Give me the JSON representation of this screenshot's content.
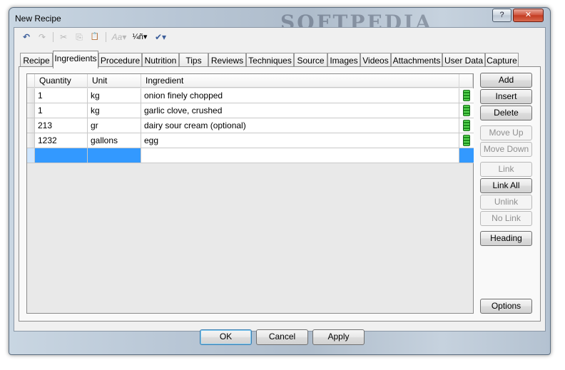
{
  "window": {
    "title": "New Recipe",
    "watermark": "SOFTPEDIA",
    "help_label": "?",
    "close_label": "✕"
  },
  "toolbar": {
    "undo": "↶",
    "redo": "↷",
    "cut": "✂",
    "copy": "⎘",
    "paste": "📋",
    "font": "Aa▾",
    "fraction": "¼ñ▾",
    "spell": "✔▾"
  },
  "tabs": [
    "Recipe",
    "Ingredients",
    "Procedure",
    "Nutrition",
    "Tips",
    "Reviews",
    "Techniques",
    "Source",
    "Images",
    "Videos",
    "Attachments",
    "User Data",
    "Capture"
  ],
  "active_tab": "Ingredients",
  "grid": {
    "columns": [
      "Quantity",
      "Unit",
      "Ingredient"
    ],
    "rows": [
      {
        "quantity": "1",
        "unit": "kg",
        "ingredient": "onion finely chopped"
      },
      {
        "quantity": "1",
        "unit": "kg",
        "ingredient": "garlic clove, crushed"
      },
      {
        "quantity": "213",
        "unit": "gr",
        "ingredient": "dairy sour cream (optional)"
      },
      {
        "quantity": "1232",
        "unit": "gallons",
        "ingredient": "egg"
      }
    ]
  },
  "side_buttons": {
    "add": "Add",
    "insert": "Insert",
    "delete": "Delete",
    "move_up": "Move Up",
    "move_down": "Move Down",
    "link": "Link",
    "link_all": "Link All",
    "unlink": "Unlink",
    "no_link": "No Link",
    "heading": "Heading",
    "options": "Options"
  },
  "dialog_buttons": {
    "ok": "OK",
    "cancel": "Cancel",
    "apply": "Apply"
  },
  "colors": {
    "selection": "#3399ff",
    "status_green": "#2fae2f"
  }
}
